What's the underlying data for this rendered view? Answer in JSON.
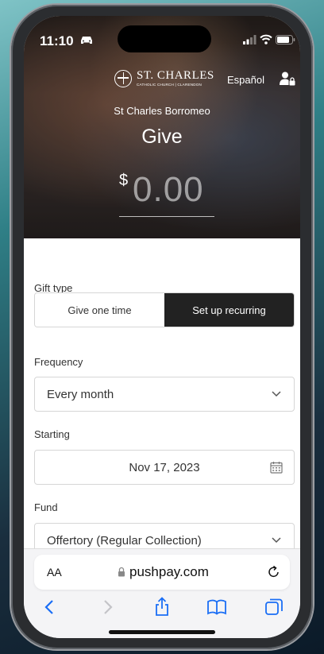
{
  "status": {
    "time": "11:10"
  },
  "header": {
    "brand_name": "ST. CHARLES",
    "brand_sub": "CATHOLIC CHURCH | CLARENDON",
    "language": "Español"
  },
  "hero": {
    "church": "St Charles Borromeo",
    "title": "Give",
    "currency": "$",
    "amount": "0.00"
  },
  "form": {
    "gift_type_label": "Gift type",
    "gift_type_options": [
      "Give one time",
      "Set up recurring"
    ],
    "gift_type_selected": "Set up recurring",
    "frequency_label": "Frequency",
    "frequency_value": "Every month",
    "starting_label": "Starting",
    "starting_value": "Nov 17, 2023",
    "fund_label": "Fund",
    "fund_value": "Offertory (Regular Collection)"
  },
  "browser": {
    "text_size": "AA",
    "url": "pushpay.com",
    "toolbar": [
      "back-icon",
      "forward-icon",
      "share-icon",
      "bookmarks-icon",
      "tabs-icon"
    ]
  },
  "colors": {
    "accent": "#1a6ef5",
    "segment_active": "#222222"
  }
}
